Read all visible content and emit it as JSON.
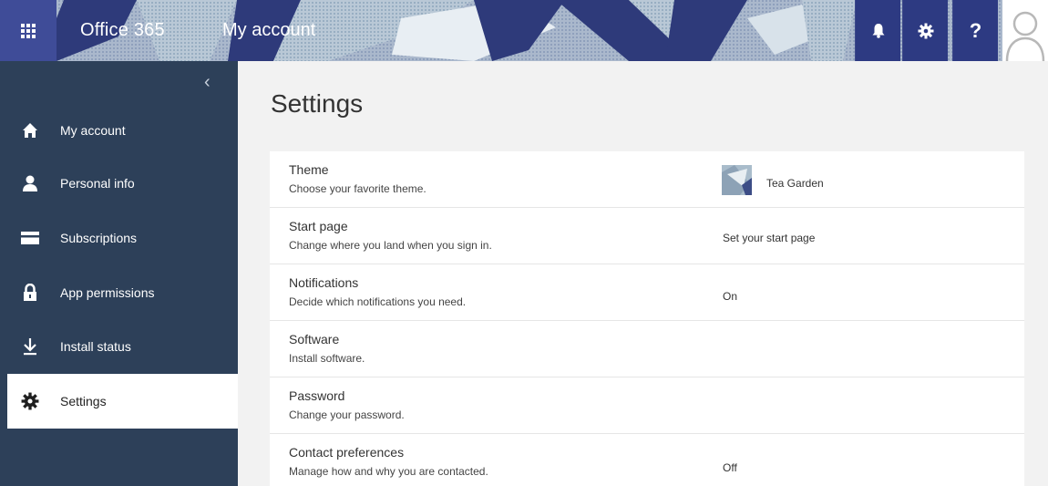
{
  "header": {
    "brand": "Office 365",
    "app_title": "My account",
    "icons": [
      "waffle-icon",
      "bell-icon",
      "gear-icon",
      "help-icon",
      "avatar-icon"
    ],
    "help_glyph": "?"
  },
  "sidebar": {
    "collapse_glyph": "‹",
    "items": [
      {
        "label": "My account",
        "icon": "home-icon"
      },
      {
        "label": "Personal info",
        "icon": "person-icon"
      },
      {
        "label": "Subscriptions",
        "icon": "card-icon"
      },
      {
        "label": "App permissions",
        "icon": "lock-icon"
      },
      {
        "label": "Install status",
        "icon": "download-icon"
      },
      {
        "label": "Settings",
        "icon": "gear-icon",
        "active": true
      }
    ]
  },
  "main": {
    "title": "Settings",
    "rows": [
      {
        "title": "Theme",
        "description": "Choose your favorite theme.",
        "value": "Tea Garden"
      },
      {
        "title": "Start page",
        "description": "Change where you land when you sign in.",
        "value": "Set your start page"
      },
      {
        "title": "Notifications",
        "description": "Decide which notifications you need.",
        "value": "On"
      },
      {
        "title": "Software",
        "description": "Install software.",
        "value": ""
      },
      {
        "title": "Password",
        "description": "Change your password.",
        "value": ""
      },
      {
        "title": "Contact preferences",
        "description": "Manage how and why you are contacted.",
        "value": "Off"
      }
    ]
  },
  "colors": {
    "topbar": "#2e3a7a",
    "sidebar": "#2d4059",
    "page_background": "#f2f2f2",
    "card": "#ffffff"
  }
}
